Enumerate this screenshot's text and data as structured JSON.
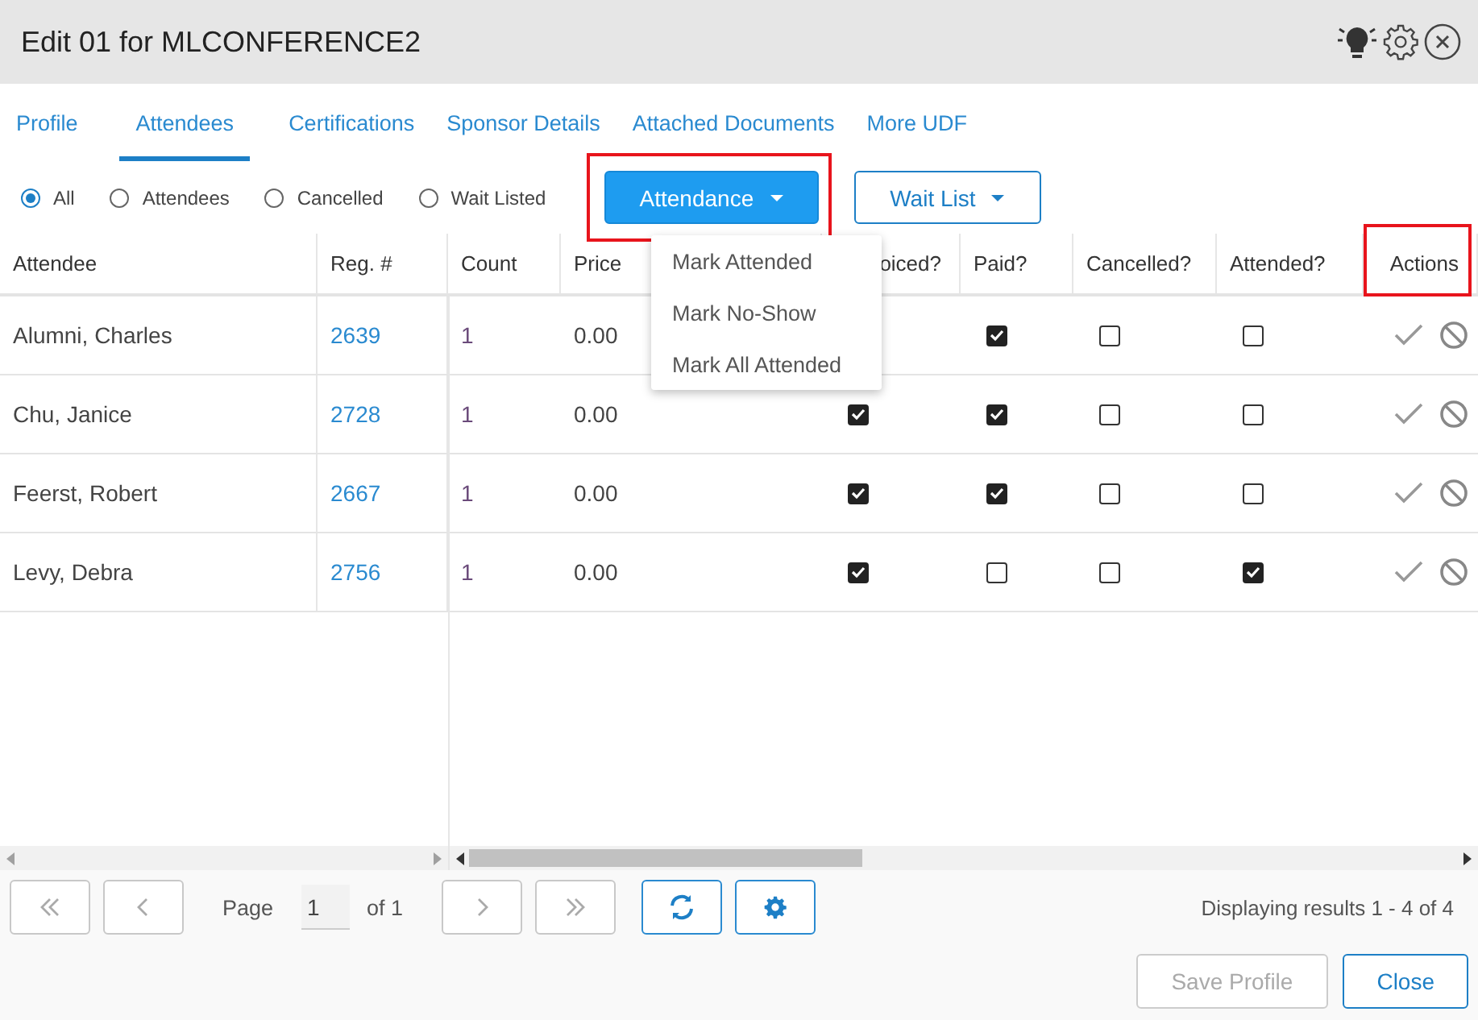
{
  "window": {
    "title": "Edit 01 for MLCONFERENCE2"
  },
  "tabs": [
    {
      "label": "Profile",
      "selected": false
    },
    {
      "label": "Attendees",
      "selected": true
    },
    {
      "label": "Certifications",
      "selected": false
    },
    {
      "label": "Sponsor Details",
      "selected": false
    },
    {
      "label": "Attached Documents",
      "selected": false
    },
    {
      "label": "More UDF",
      "selected": false
    }
  ],
  "filters": [
    {
      "label": "All",
      "selected": true
    },
    {
      "label": "Attendees",
      "selected": false
    },
    {
      "label": "Cancelled",
      "selected": false
    },
    {
      "label": "Wait Listed",
      "selected": false
    }
  ],
  "buttons": [
    {
      "label": "Attendance",
      "kind": "primary",
      "highlighted": true
    },
    {
      "label": "Wait List",
      "kind": "outline",
      "highlighted": false
    }
  ],
  "menu": {
    "items": [
      "Mark Attended",
      "Mark No-Show",
      "Mark All Attended"
    ]
  },
  "table": {
    "columns": [
      {
        "label": "Attendee",
        "highlighted": false
      },
      {
        "label": "Reg. #",
        "highlighted": false
      },
      {
        "label": "Count",
        "highlighted": false
      },
      {
        "label": "Price",
        "highlighted": false
      },
      {
        "label": "oiced?",
        "highlighted": false
      },
      {
        "label": "Paid?",
        "highlighted": false
      },
      {
        "label": "Cancelled?",
        "highlighted": false
      },
      {
        "label": "Attended?",
        "highlighted": false
      },
      {
        "label": "Actions",
        "highlighted": true
      }
    ],
    "rows": [
      {
        "attendee": "Alumni, Charles",
        "reg": "2639",
        "count": "1",
        "price": "0.00",
        "invoiced": null,
        "paid": true,
        "cancelled": false,
        "attended": false
      },
      {
        "attendee": "Chu, Janice",
        "reg": "2728",
        "count": "1",
        "price": "0.00",
        "invoiced": true,
        "paid": true,
        "cancelled": false,
        "attended": false
      },
      {
        "attendee": "Feerst, Robert",
        "reg": "2667",
        "count": "1",
        "price": "0.00",
        "invoiced": true,
        "paid": true,
        "cancelled": false,
        "attended": false
      },
      {
        "attendee": "Levy, Debra",
        "reg": "2756",
        "count": "1",
        "price": "0.00",
        "invoiced": true,
        "paid": false,
        "cancelled": false,
        "attended": true
      }
    ]
  },
  "pager": {
    "page_label": "Page",
    "page": "1",
    "of": "of 1",
    "status": "Displaying results 1 - 4 of 4"
  },
  "footer": {
    "buttons": [
      {
        "label": "Save Profile",
        "disabled": true
      },
      {
        "label": "Close",
        "disabled": false
      }
    ]
  }
}
